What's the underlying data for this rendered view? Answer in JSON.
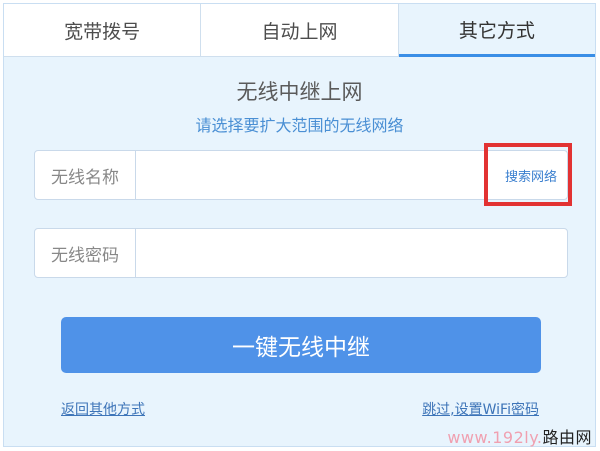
{
  "tabs": [
    {
      "label": "宽带拨号",
      "active": false
    },
    {
      "label": "自动上网",
      "active": false
    },
    {
      "label": "其它方式",
      "active": true
    }
  ],
  "header": {
    "title": "无线中继上网",
    "subtitle": "请选择要扩大范围的无线网络"
  },
  "ssid_field": {
    "label": "无线名称",
    "value": "",
    "placeholder": "",
    "search_label": "搜索网络"
  },
  "password_field": {
    "label": "无线密码",
    "value": "",
    "placeholder": ""
  },
  "primary_button": {
    "label": "一键无线中继"
  },
  "links": {
    "back": "返回其他方式",
    "skip": "跳过,设置WiFi密码"
  },
  "watermark": {
    "url": "www.192ly.",
    "brand": "路由网"
  },
  "colors": {
    "accent": "#4f92e8",
    "highlight": "#e23232",
    "panel_bg": "#e8f4fd"
  }
}
